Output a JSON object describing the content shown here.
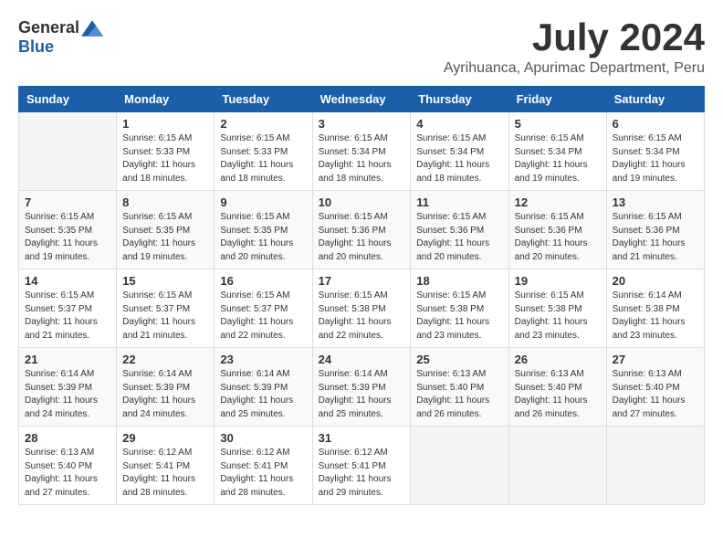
{
  "logo": {
    "general": "General",
    "blue": "Blue"
  },
  "title": {
    "month_year": "July 2024",
    "location": "Ayrihuanca, Apurimac Department, Peru"
  },
  "weekdays": [
    "Sunday",
    "Monday",
    "Tuesday",
    "Wednesday",
    "Thursday",
    "Friday",
    "Saturday"
  ],
  "weeks": [
    [
      {
        "day": "",
        "info": ""
      },
      {
        "day": "1",
        "info": "Sunrise: 6:15 AM\nSunset: 5:33 PM\nDaylight: 11 hours\nand 18 minutes."
      },
      {
        "day": "2",
        "info": "Sunrise: 6:15 AM\nSunset: 5:33 PM\nDaylight: 11 hours\nand 18 minutes."
      },
      {
        "day": "3",
        "info": "Sunrise: 6:15 AM\nSunset: 5:34 PM\nDaylight: 11 hours\nand 18 minutes."
      },
      {
        "day": "4",
        "info": "Sunrise: 6:15 AM\nSunset: 5:34 PM\nDaylight: 11 hours\nand 18 minutes."
      },
      {
        "day": "5",
        "info": "Sunrise: 6:15 AM\nSunset: 5:34 PM\nDaylight: 11 hours\nand 19 minutes."
      },
      {
        "day": "6",
        "info": "Sunrise: 6:15 AM\nSunset: 5:34 PM\nDaylight: 11 hours\nand 19 minutes."
      }
    ],
    [
      {
        "day": "7",
        "info": "Sunrise: 6:15 AM\nSunset: 5:35 PM\nDaylight: 11 hours\nand 19 minutes."
      },
      {
        "day": "8",
        "info": "Sunrise: 6:15 AM\nSunset: 5:35 PM\nDaylight: 11 hours\nand 19 minutes."
      },
      {
        "day": "9",
        "info": "Sunrise: 6:15 AM\nSunset: 5:35 PM\nDaylight: 11 hours\nand 20 minutes."
      },
      {
        "day": "10",
        "info": "Sunrise: 6:15 AM\nSunset: 5:36 PM\nDaylight: 11 hours\nand 20 minutes."
      },
      {
        "day": "11",
        "info": "Sunrise: 6:15 AM\nSunset: 5:36 PM\nDaylight: 11 hours\nand 20 minutes."
      },
      {
        "day": "12",
        "info": "Sunrise: 6:15 AM\nSunset: 5:36 PM\nDaylight: 11 hours\nand 20 minutes."
      },
      {
        "day": "13",
        "info": "Sunrise: 6:15 AM\nSunset: 5:36 PM\nDaylight: 11 hours\nand 21 minutes."
      }
    ],
    [
      {
        "day": "14",
        "info": "Sunrise: 6:15 AM\nSunset: 5:37 PM\nDaylight: 11 hours\nand 21 minutes."
      },
      {
        "day": "15",
        "info": "Sunrise: 6:15 AM\nSunset: 5:37 PM\nDaylight: 11 hours\nand 21 minutes."
      },
      {
        "day": "16",
        "info": "Sunrise: 6:15 AM\nSunset: 5:37 PM\nDaylight: 11 hours\nand 22 minutes."
      },
      {
        "day": "17",
        "info": "Sunrise: 6:15 AM\nSunset: 5:38 PM\nDaylight: 11 hours\nand 22 minutes."
      },
      {
        "day": "18",
        "info": "Sunrise: 6:15 AM\nSunset: 5:38 PM\nDaylight: 11 hours\nand 23 minutes."
      },
      {
        "day": "19",
        "info": "Sunrise: 6:15 AM\nSunset: 5:38 PM\nDaylight: 11 hours\nand 23 minutes."
      },
      {
        "day": "20",
        "info": "Sunrise: 6:14 AM\nSunset: 5:38 PM\nDaylight: 11 hours\nand 23 minutes."
      }
    ],
    [
      {
        "day": "21",
        "info": "Sunrise: 6:14 AM\nSunset: 5:39 PM\nDaylight: 11 hours\nand 24 minutes."
      },
      {
        "day": "22",
        "info": "Sunrise: 6:14 AM\nSunset: 5:39 PM\nDaylight: 11 hours\nand 24 minutes."
      },
      {
        "day": "23",
        "info": "Sunrise: 6:14 AM\nSunset: 5:39 PM\nDaylight: 11 hours\nand 25 minutes."
      },
      {
        "day": "24",
        "info": "Sunrise: 6:14 AM\nSunset: 5:39 PM\nDaylight: 11 hours\nand 25 minutes."
      },
      {
        "day": "25",
        "info": "Sunrise: 6:13 AM\nSunset: 5:40 PM\nDaylight: 11 hours\nand 26 minutes."
      },
      {
        "day": "26",
        "info": "Sunrise: 6:13 AM\nSunset: 5:40 PM\nDaylight: 11 hours\nand 26 minutes."
      },
      {
        "day": "27",
        "info": "Sunrise: 6:13 AM\nSunset: 5:40 PM\nDaylight: 11 hours\nand 27 minutes."
      }
    ],
    [
      {
        "day": "28",
        "info": "Sunrise: 6:13 AM\nSunset: 5:40 PM\nDaylight: 11 hours\nand 27 minutes."
      },
      {
        "day": "29",
        "info": "Sunrise: 6:12 AM\nSunset: 5:41 PM\nDaylight: 11 hours\nand 28 minutes."
      },
      {
        "day": "30",
        "info": "Sunrise: 6:12 AM\nSunset: 5:41 PM\nDaylight: 11 hours\nand 28 minutes."
      },
      {
        "day": "31",
        "info": "Sunrise: 6:12 AM\nSunset: 5:41 PM\nDaylight: 11 hours\nand 29 minutes."
      },
      {
        "day": "",
        "info": ""
      },
      {
        "day": "",
        "info": ""
      },
      {
        "day": "",
        "info": ""
      }
    ]
  ]
}
